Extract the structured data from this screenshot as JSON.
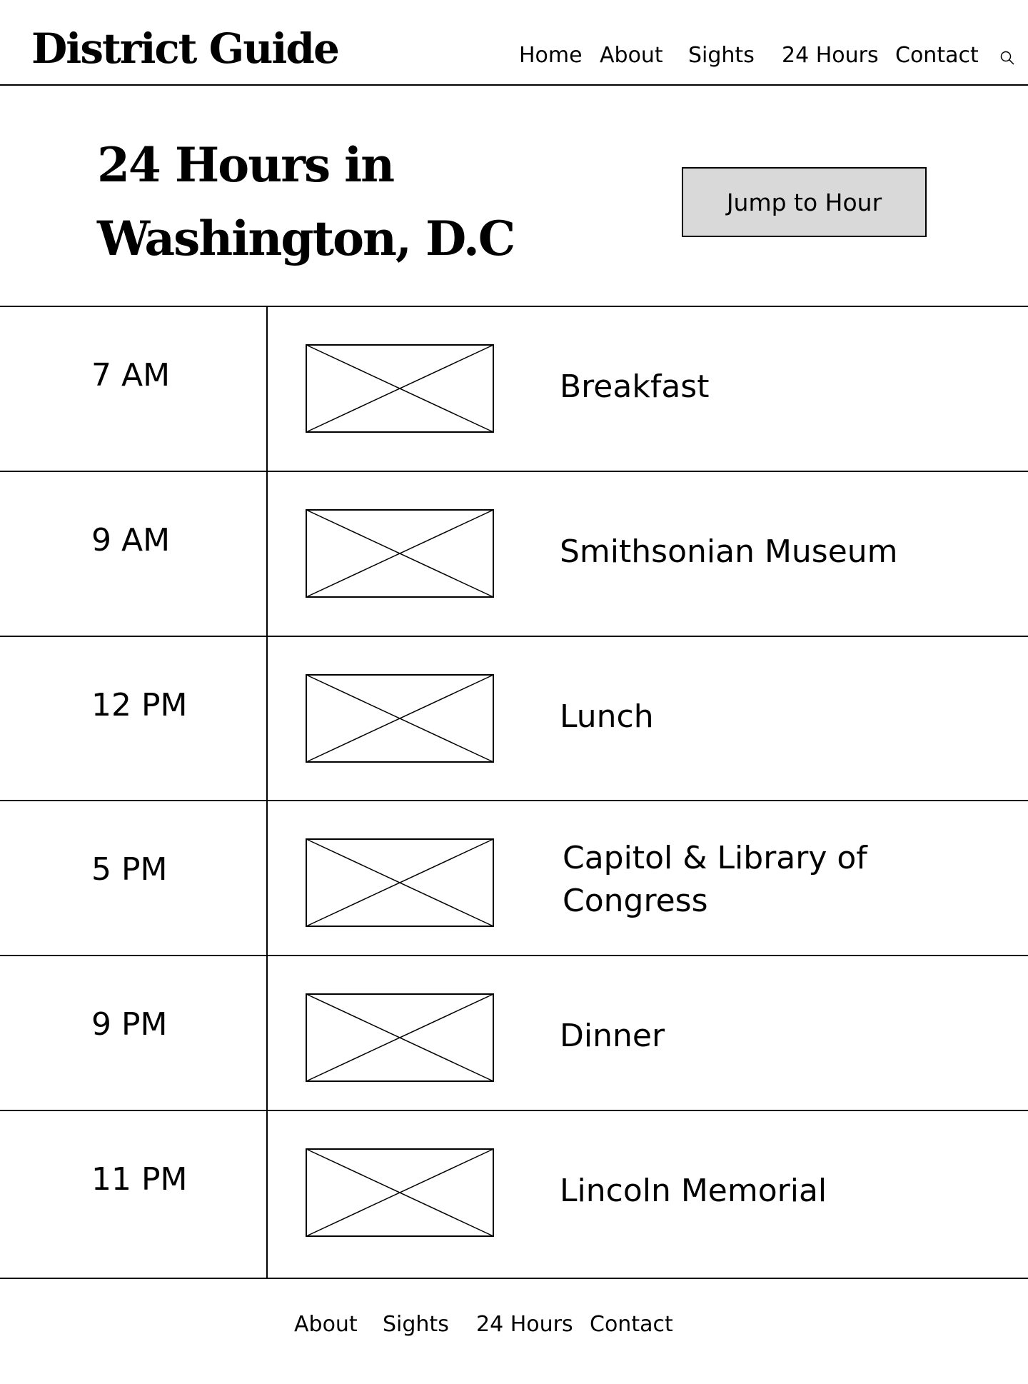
{
  "header": {
    "brand": "District Guide",
    "nav": [
      {
        "label": "Home"
      },
      {
        "label": "About"
      },
      {
        "label": "Sights"
      },
      {
        "label": "24 Hours"
      },
      {
        "label": "Contact"
      }
    ],
    "search_icon": "search-icon"
  },
  "hero": {
    "title_line1": "24 Hours in",
    "title_line2": "Washington, D.C",
    "jump_button": "Jump to Hour"
  },
  "schedule": [
    {
      "time": "7 AM",
      "title": "Breakfast",
      "image_icon": "image-placeholder-icon"
    },
    {
      "time": "9 AM",
      "title": "Smithsonian Museum",
      "image_icon": "image-placeholder-icon"
    },
    {
      "time": "12 PM",
      "title": "Lunch",
      "image_icon": "image-placeholder-icon"
    },
    {
      "time": "5 PM",
      "title": "Capitol & Library of Congress",
      "image_icon": "image-placeholder-icon"
    },
    {
      "time": "9 PM",
      "title": "Dinner",
      "image_icon": "image-placeholder-icon"
    },
    {
      "time": "11 PM",
      "title": "Lincoln Memorial",
      "image_icon": "image-placeholder-icon"
    }
  ],
  "footer": {
    "nav": [
      {
        "label": "About"
      },
      {
        "label": "Sights"
      },
      {
        "label": "24 Hours"
      },
      {
        "label": "Contact"
      }
    ]
  }
}
